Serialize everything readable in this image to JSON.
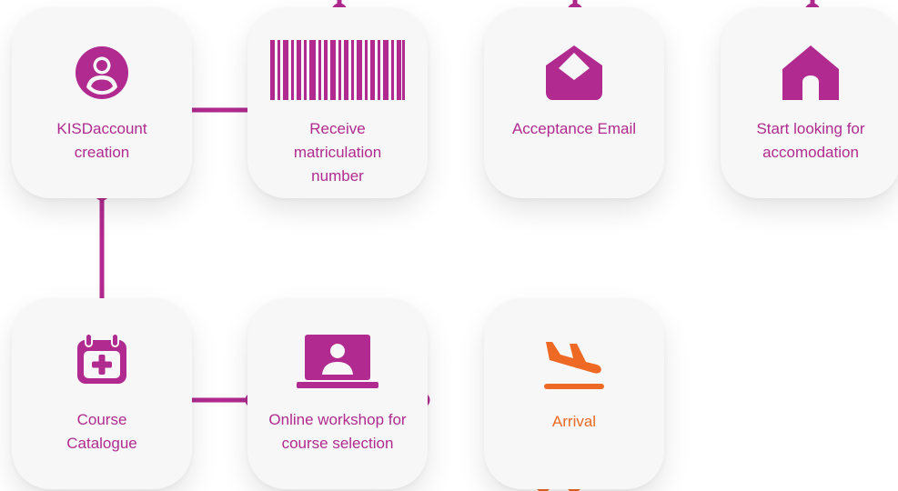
{
  "colors": {
    "primary": "#b02a8f",
    "accent": "#ee6a24",
    "card_background": "#f7f7f7"
  },
  "steps": [
    {
      "label": "KISDaccount\ncreation",
      "icon": "user-circle-icon"
    },
    {
      "label": "Receive\nmatriculation\nnumber",
      "icon": "barcode-icon"
    },
    {
      "label": "Acceptance Email",
      "icon": "open-envelope-icon"
    },
    {
      "label": "Start looking for\naccomodation",
      "icon": "house-icon"
    },
    {
      "label": "Course\nCatalogue",
      "icon": "calendar-plus-icon"
    },
    {
      "label": "Online workshop for\ncourse selection",
      "icon": "laptop-person-icon"
    },
    {
      "label": "Arrival",
      "icon": "airplane-landing-icon"
    }
  ]
}
